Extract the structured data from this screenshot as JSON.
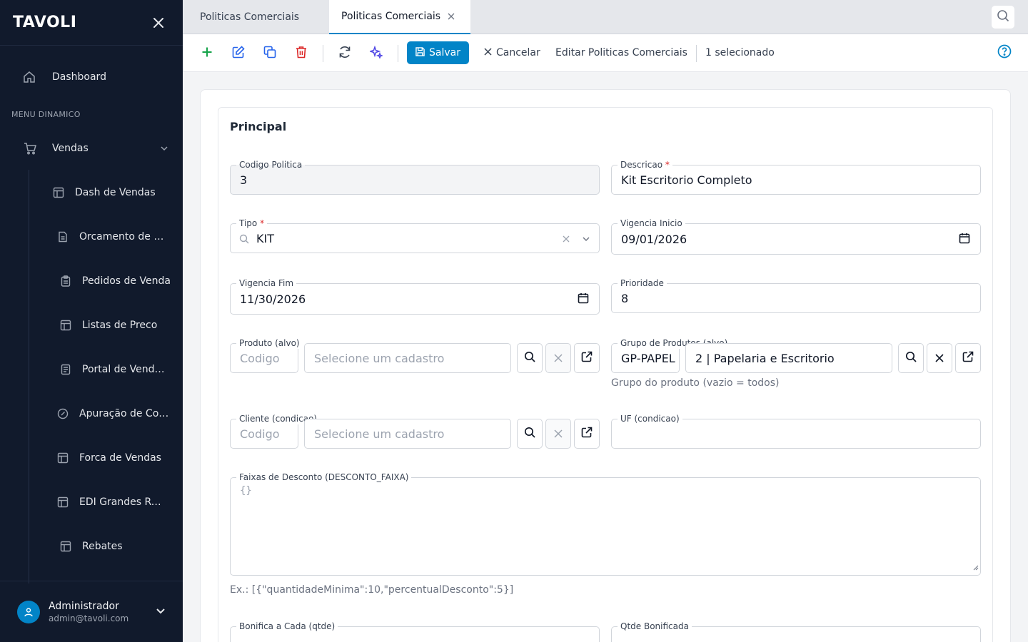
{
  "sidebar": {
    "logo": "TAVOLI",
    "dashboard_label": "Dashboard",
    "section_label": "MENU DINAMICO",
    "vendas_label": "Vendas",
    "sub_items": [
      {
        "label": "Dash de Vendas",
        "icon": "layout-icon"
      },
      {
        "label": "Orcamento de Vendas",
        "icon": "document-icon"
      },
      {
        "label": "Pedidos de Venda",
        "icon": "clipboard-icon"
      },
      {
        "label": "Listas de Preco",
        "icon": "layout-icon"
      },
      {
        "label": "Portal de Vendas",
        "icon": "document-lines-icon"
      },
      {
        "label": "Apuração de Comissões",
        "icon": "gauge-icon"
      },
      {
        "label": "Forca de Vendas",
        "icon": "layout-icon"
      },
      {
        "label": "EDI Grandes Redes",
        "icon": "layout-icon"
      },
      {
        "label": "Rebates",
        "icon": "layout-icon"
      }
    ],
    "user": {
      "name": "Administrador",
      "email": "admin@tavoli.com"
    }
  },
  "tabs": [
    {
      "label": "Politicas Comerciais",
      "active": false
    },
    {
      "label": "Politicas Comerciais",
      "active": true
    }
  ],
  "toolbar": {
    "save_label": "Salvar",
    "cancel_label": "Cancelar",
    "edit_label": "Editar Politicas Comerciais",
    "selected_label": "1 selecionado"
  },
  "form": {
    "section_title": "Principal",
    "codigo_politica": {
      "label": "Codigo Politica",
      "value": "3"
    },
    "descricao": {
      "label": "Descricao",
      "required_mark": "*",
      "value": "Kit Escritorio Completo"
    },
    "tipo": {
      "label": "Tipo",
      "required_mark": "*",
      "value": "KIT"
    },
    "vigencia_inicio": {
      "label": "Vigencia Inicio",
      "value": "09/01/2026"
    },
    "vigencia_fim": {
      "label": "Vigencia Fim",
      "value": "11/30/2026"
    },
    "prioridade": {
      "label": "Prioridade",
      "value": "8"
    },
    "produto": {
      "label": "Produto (alvo)",
      "code_placeholder": "Codigo",
      "name_placeholder": "Selecione um cadastro"
    },
    "grupo_produtos": {
      "label": "Grupo de Produtos (alvo)",
      "code_value": "GP-PAPEL",
      "name_value": "2 | Papelaria e Escritorio",
      "hint": "Grupo do produto (vazio = todos)"
    },
    "cliente": {
      "label": "Cliente (condicao)",
      "code_placeholder": "Codigo",
      "name_placeholder": "Selecione um cadastro"
    },
    "uf": {
      "label": "UF (condicao)",
      "value": ""
    },
    "faixas_desconto": {
      "label": "Faixas de Desconto (DESCONTO_FAIXA)",
      "placeholder": "{}",
      "hint": "Ex.: [{\"quantidadeMinima\":10,\"percentualDesconto\":5}]"
    },
    "bonifica_cada": {
      "label": "Bonifica a Cada (qtde)"
    },
    "qtde_bonificada": {
      "label": "Qtde Bonificada"
    }
  },
  "colors": {
    "sidebar_bg": "#111a2c",
    "accent": "#0284c7",
    "add": "#16a34a",
    "edit": "#2563eb",
    "delete": "#dc2626",
    "magic": "#4f46e5"
  }
}
